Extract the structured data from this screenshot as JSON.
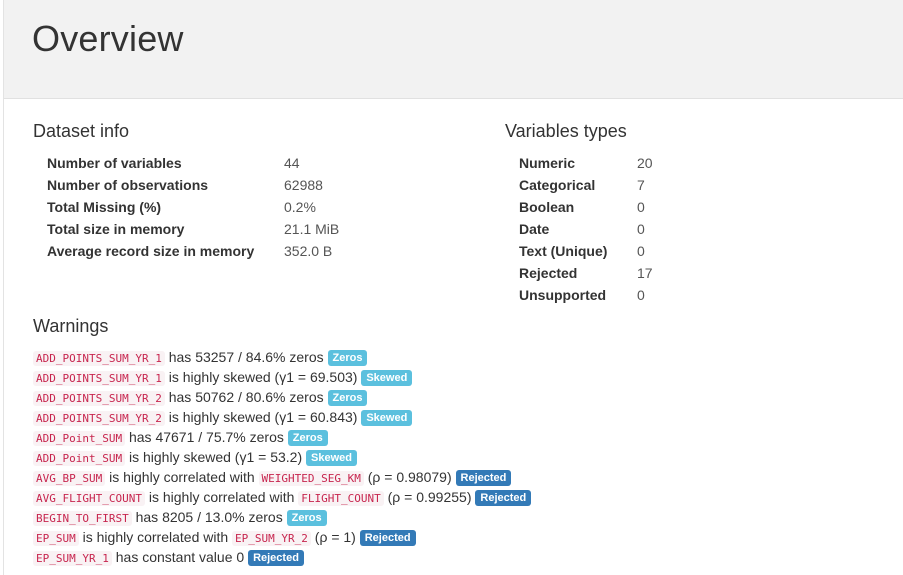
{
  "overview": {
    "title": "Overview"
  },
  "dataset_info": {
    "title": "Dataset info",
    "rows": [
      {
        "label": "Number of variables",
        "value": "44"
      },
      {
        "label": "Number of observations",
        "value": "62988"
      },
      {
        "label": "Total Missing (%)",
        "value": "0.2%"
      },
      {
        "label": "Total size in memory",
        "value": "21.1 MiB"
      },
      {
        "label": "Average record size in memory",
        "value": "352.0 B"
      }
    ]
  },
  "variable_types": {
    "title": "Variables types",
    "rows": [
      {
        "label": "Numeric",
        "value": "20"
      },
      {
        "label": "Categorical",
        "value": "7"
      },
      {
        "label": "Boolean",
        "value": "0"
      },
      {
        "label": "Date",
        "value": "0"
      },
      {
        "label": "Text (Unique)",
        "value": "0"
      },
      {
        "label": "Rejected",
        "value": "17"
      },
      {
        "label": "Unsupported",
        "value": "0"
      }
    ]
  },
  "warnings": {
    "title": "Warnings",
    "badge_colors": {
      "info": "#5bc0de",
      "primary": "#337ab7"
    },
    "items": [
      {
        "var": "ADD_POINTS_SUM_YR_1",
        "text": "has 53257 / 84.6% zeros",
        "badge": "Zeros",
        "badge_style": "info"
      },
      {
        "var": "ADD_POINTS_SUM_YR_1",
        "text": "is highly skewed (γ1 = 69.503)",
        "badge": "Skewed",
        "badge_style": "info"
      },
      {
        "var": "ADD_POINTS_SUM_YR_2",
        "text": "has 50762 / 80.6% zeros",
        "badge": "Zeros",
        "badge_style": "info"
      },
      {
        "var": "ADD_POINTS_SUM_YR_2",
        "text": "is highly skewed (γ1 = 60.843)",
        "badge": "Skewed",
        "badge_style": "info"
      },
      {
        "var": "ADD_Point_SUM",
        "text": "has 47671 / 75.7% zeros",
        "badge": "Zeros",
        "badge_style": "info"
      },
      {
        "var": "ADD_Point_SUM",
        "text": "is highly skewed (γ1 = 53.2)",
        "badge": "Skewed",
        "badge_style": "info"
      },
      {
        "var": "AVG_BP_SUM",
        "text": "is highly correlated with",
        "corr_var": "WEIGHTED_SEG_KM",
        "tail": "(ρ = 0.98079)",
        "badge": "Rejected",
        "badge_style": "primary"
      },
      {
        "var": "AVG_FLIGHT_COUNT",
        "text": "is highly correlated with",
        "corr_var": "FLIGHT_COUNT",
        "tail": "(ρ = 0.99255)",
        "badge": "Rejected",
        "badge_style": "primary"
      },
      {
        "var": "BEGIN_TO_FIRST",
        "text": "has 8205 / 13.0% zeros",
        "badge": "Zeros",
        "badge_style": "info"
      },
      {
        "var": "EP_SUM",
        "text": "is highly correlated with",
        "corr_var": "EP_SUM_YR_2",
        "tail": "(ρ = 1)",
        "badge": "Rejected",
        "badge_style": "primary"
      },
      {
        "var": "EP_SUM_YR_1",
        "text": "has constant value 0",
        "badge": "Rejected",
        "badge_style": "primary"
      }
    ]
  }
}
